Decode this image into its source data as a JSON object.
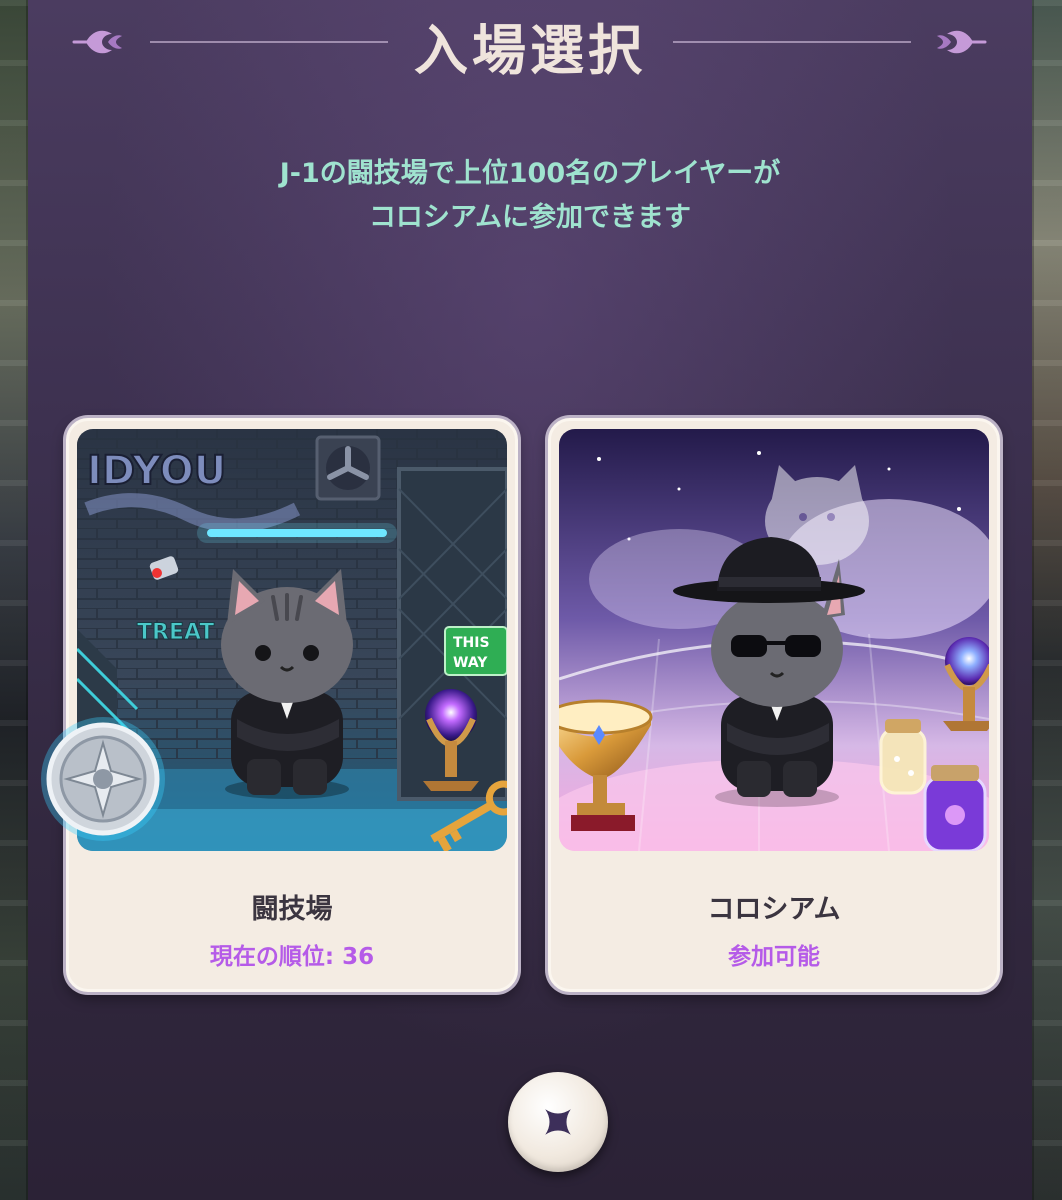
{
  "dialog": {
    "title": "入場選択",
    "description_lines": [
      "J-1の闘技場で上位100名のプレイヤーが",
      "コロシアムに参加できます"
    ]
  },
  "cards": [
    {
      "name": "闘技場",
      "status": "現在の順位: 36",
      "art_sign": "THIS WAY",
      "art_graffiti": "IDYOU"
    },
    {
      "name": "コロシアム",
      "status": "参加可能"
    }
  ],
  "close_button": {
    "icon": "close-icon"
  },
  "colors": {
    "panel": "#3d3150",
    "title_text": "#efe4dc",
    "description_text": "#9fe3cf",
    "card_background": "#f4ece3",
    "status_text": "#b55be8",
    "close_icon": "#3d2f5a"
  }
}
